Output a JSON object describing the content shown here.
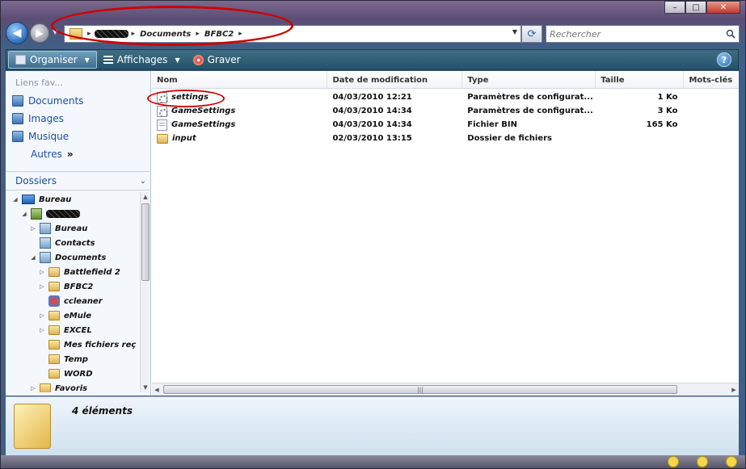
{
  "address": {
    "crumbs": [
      "Documents",
      "BFBC2"
    ],
    "separator": "▸"
  },
  "search": {
    "placeholder": "Rechercher"
  },
  "toolbar": {
    "organize_label": "Organiser",
    "views_label": "Affichages",
    "burn_label": "Graver",
    "help_label": "?"
  },
  "favorites": {
    "header": "Liens fav...",
    "items": [
      "Documents",
      "Images",
      "Musique"
    ],
    "more_label": "Autres"
  },
  "folders_header": "Dossiers",
  "tree": [
    {
      "label": "Bureau",
      "indent": 0,
      "icon": "desktop-icon",
      "expander": "◢"
    },
    {
      "label": "",
      "indent": 1,
      "icon": "user-icon",
      "expander": "◢"
    },
    {
      "label": "Bureau",
      "indent": 2,
      "icon": "library-icon",
      "expander": "▷"
    },
    {
      "label": "Contacts",
      "indent": 2,
      "icon": "library-icon",
      "expander": ""
    },
    {
      "label": "Documents",
      "indent": 2,
      "icon": "library-icon",
      "expander": "◢"
    },
    {
      "label": "Battlefield 2",
      "indent": 3,
      "icon": "folder-icon",
      "expander": "▷"
    },
    {
      "label": "BFBC2",
      "indent": 3,
      "icon": "folder-icon",
      "expander": "▷"
    },
    {
      "label": "ccleaner",
      "indent": 3,
      "icon": "app-icon",
      "expander": ""
    },
    {
      "label": "eMule",
      "indent": 3,
      "icon": "folder-icon",
      "expander": "▷"
    },
    {
      "label": "EXCEL",
      "indent": 3,
      "icon": "folder-icon",
      "expander": "▷"
    },
    {
      "label": "Mes fichiers reç",
      "indent": 3,
      "icon": "folder-icon",
      "expander": ""
    },
    {
      "label": "Temp",
      "indent": 3,
      "icon": "folder-icon",
      "expander": ""
    },
    {
      "label": "WORD",
      "indent": 3,
      "icon": "folder-icon",
      "expander": ""
    },
    {
      "label": "Favoris",
      "indent": 2,
      "icon": "folder-icon",
      "expander": "▷"
    }
  ],
  "columns": [
    "Nom",
    "Date de modification",
    "Type",
    "Taille",
    "Mots-clés"
  ],
  "files": [
    {
      "name": "settings",
      "date": "04/03/2010 12:21",
      "type": "Paramètres de configurat...",
      "size": "1 Ko",
      "icon": "config-file-icon"
    },
    {
      "name": "GameSettings",
      "date": "04/03/2010 14:34",
      "type": "Paramètres de configurat...",
      "size": "3 Ko",
      "icon": "config-file-icon"
    },
    {
      "name": "GameSettings",
      "date": "04/03/2010 14:34",
      "type": "Fichier BIN",
      "size": "165 Ko",
      "icon": "bin-file-icon"
    },
    {
      "name": "input",
      "date": "02/03/2010 13:15",
      "type": "Dossier de fichiers",
      "size": "",
      "icon": "folder-icon"
    }
  ],
  "details": {
    "count": "4 éléments"
  },
  "colors": {
    "annotation": "#d00000",
    "link": "#1c4fa2",
    "toolbar": "#24526a"
  }
}
